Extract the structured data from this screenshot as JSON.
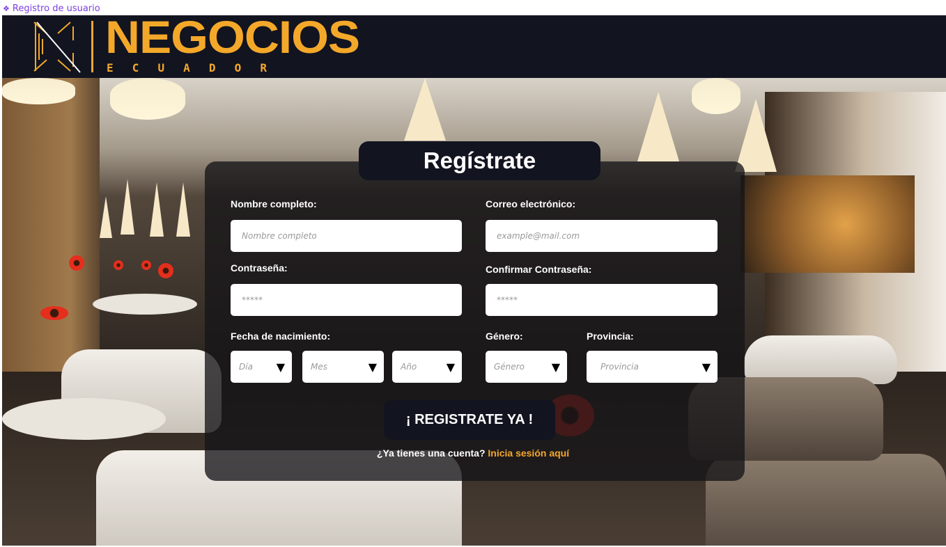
{
  "tab": {
    "label": "Registro de usuario",
    "icon": "diamond-icon",
    "color": "#7b3fe4"
  },
  "brand": {
    "name": "NEGOCIOS",
    "sub_letters": [
      "E",
      "C",
      "U",
      "A",
      "D",
      "O",
      "R"
    ],
    "accent_color": "#f4a82a",
    "header_bg": "#121420"
  },
  "form": {
    "title": "Regístrate",
    "fields": {
      "full_name": {
        "label": "Nombre completo:",
        "placeholder": "Nombre completo"
      },
      "email": {
        "label": "Correo electrónico:",
        "placeholder": "example@mail.com"
      },
      "password": {
        "label": "Contraseña:",
        "placeholder": "*****"
      },
      "confirm_password": {
        "label": "Confirmar Contraseña:",
        "placeholder": "*****"
      },
      "birth_date": {
        "label": "Fecha de nacimiento:",
        "day": "Día",
        "month": "Mes",
        "year": "Año"
      },
      "gender": {
        "label": "Género:",
        "value": "Género"
      },
      "province": {
        "label": "Provincia:",
        "value": "Provincia"
      }
    },
    "submit_label": "¡ REGISTRATE YA !",
    "login_prompt": "¿Ya tienes una cuenta?",
    "login_link": "Inicia sesión aquí"
  }
}
